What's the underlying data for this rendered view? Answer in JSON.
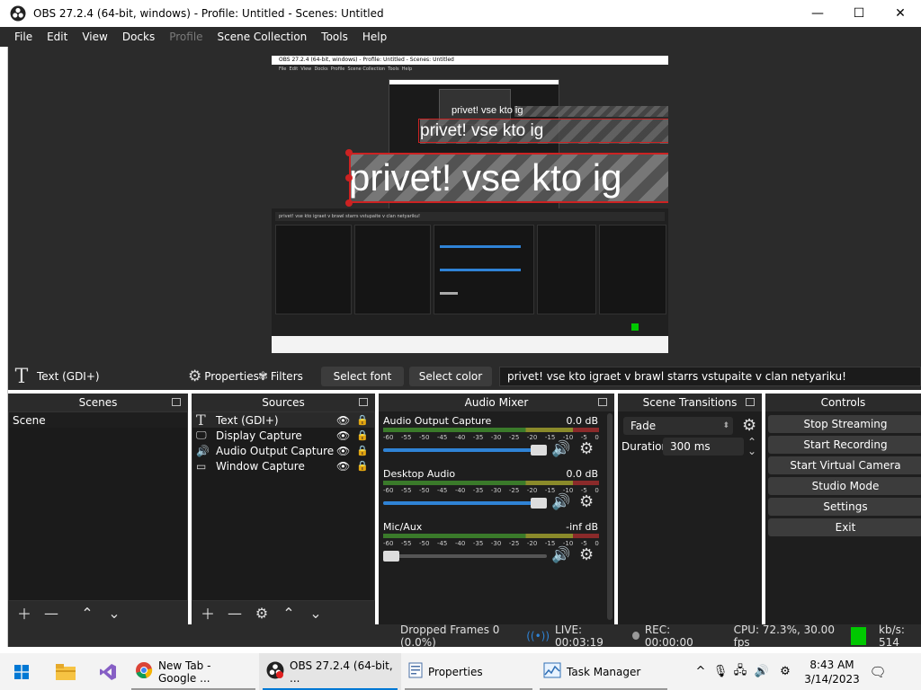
{
  "window": {
    "title": "OBS 27.2.4 (64-bit, windows) - Profile: Untitled - Scenes: Untitled",
    "minimize": "—",
    "maximize": "☐",
    "close": "✕"
  },
  "menu": [
    {
      "label": "File"
    },
    {
      "label": "Edit"
    },
    {
      "label": "View"
    },
    {
      "label": "Docks"
    },
    {
      "label": "Profile",
      "disabled": true
    },
    {
      "label": "Scene Collection"
    },
    {
      "label": "Tools"
    },
    {
      "label": "Help"
    }
  ],
  "preview": {
    "text_large": "privet! vse kto ig",
    "text_medium": "privet! vse kto ig",
    "text_small": "privet! vse kto ig",
    "nested_title": "OBS 27.2.4 (64-bit, windows) - Profile: Untitled - Scenes: Untitled",
    "nested_menu": "File  Edit  View  Docks  Profile  Scene Collection  Tools  Help",
    "nested_source_text": "privet! vse kto igraet v brawl starrs vstupaite v clan netyariku!"
  },
  "source_bar": {
    "source_name": "Text (GDI+)",
    "properties_label": "Properties",
    "filters_label": "Filters",
    "select_font_label": "Select font",
    "select_color_label": "Select color",
    "text_value": "privet! vse kto igraet v brawl starrs vstupaite v clan netyariku!"
  },
  "scenes": {
    "title": "Scenes",
    "items": [
      {
        "name": "Scene"
      }
    ]
  },
  "sources": {
    "title": "Sources",
    "items": [
      {
        "name": "Text (GDI+)",
        "icon": "text-icon"
      },
      {
        "name": "Display Capture",
        "icon": "monitor-icon"
      },
      {
        "name": "Audio Output Capture",
        "icon": "speaker-icon"
      },
      {
        "name": "Window Capture",
        "icon": "window-icon"
      }
    ]
  },
  "audio_mixer": {
    "title": "Audio Mixer",
    "ticks": [
      "-60",
      "-55",
      "-50",
      "-45",
      "-40",
      "-35",
      "-30",
      "-25",
      "-20",
      "-15",
      "-10",
      "-5",
      "0"
    ],
    "channels": [
      {
        "name": "Audio Output Capture",
        "db": "0.0 dB",
        "volume": 1.0
      },
      {
        "name": "Desktop Audio",
        "db": "0.0 dB",
        "volume": 1.0
      },
      {
        "name": "Mic/Aux",
        "db": "-inf dB",
        "volume": 0.0
      }
    ]
  },
  "transitions": {
    "title": "Scene Transitions",
    "transition": "Fade",
    "duration_label": "Duration",
    "duration_value": "300 ms"
  },
  "controls": {
    "title": "Controls",
    "buttons": [
      {
        "label": "Stop Streaming"
      },
      {
        "label": "Start Recording"
      },
      {
        "label": "Start Virtual Camera"
      },
      {
        "label": "Studio Mode"
      },
      {
        "label": "Settings"
      },
      {
        "label": "Exit"
      }
    ]
  },
  "status": {
    "dropped_frames": "Dropped Frames 0 (0.0%)",
    "live": "LIVE: 00:03:19",
    "rec": "REC: 00:00:00",
    "cpu": "CPU: 72.3%, 30.00 fps",
    "kbs": "kb/s: 514"
  },
  "taskbar": {
    "apps": [
      {
        "label": "New Tab - Google ..."
      },
      {
        "label": "OBS 27.2.4 (64-bit, ..."
      },
      {
        "label": "Properties"
      },
      {
        "label": "Task Manager"
      }
    ],
    "time": "8:43 AM",
    "date": "3/14/2023"
  },
  "colors": {
    "accent": "#2f83d6",
    "selection": "#cc2222",
    "live_green": "#00c800"
  }
}
